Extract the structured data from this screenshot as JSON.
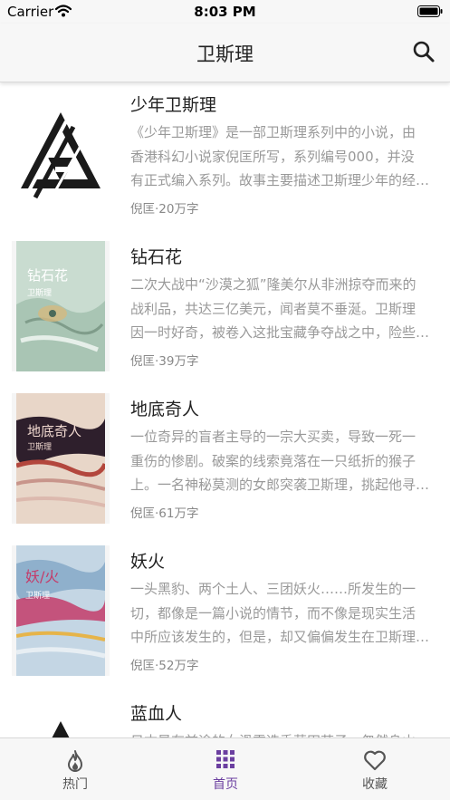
{
  "status_bar": {
    "carrier": "Carrier",
    "time": "8:03 PM"
  },
  "nav": {
    "title": "卫斯理",
    "search_icon": "search-icon"
  },
  "books": [
    {
      "title": "少年卫斯理",
      "desc_lines": [
        "《少年卫斯理》是一部卫斯理系列中的小说，由",
        "香港科幻小说家倪匡所写，系列编号000，并没",
        "有正式编入系列。故事主要描述卫斯理少年的经…"
      ],
      "meta": "倪匡·20万字",
      "cover": "triangle-logo"
    },
    {
      "title": "钻石花",
      "desc_lines": [
        "二次大战中“沙漠之狐”隆美尔从非洲掠夺而来的",
        "战利品，共达三亿美元，闻者莫不垂涎。卫斯理",
        "因一时好奇，被卷入这批宝藏争夺战之中，险些…"
      ],
      "meta": "倪匡·39万字",
      "cover": "green-book",
      "cover_text": [
        "钻石花",
        "卫斯理"
      ]
    },
    {
      "title": "地底奇人",
      "desc_lines": [
        "一位奇异的盲者主导的一宗大买卖，导致一死一",
        "重伤的惨剧。破案的线索竟落在一只纸折的猴子",
        "上。一名神秘莫测的女郎突袭卫斯理，挑起他寻…"
      ],
      "meta": "倪匡·61万字",
      "cover": "red-book",
      "cover_text": [
        "地底奇人",
        "卫斯理"
      ]
    },
    {
      "title": "妖火",
      "desc_lines": [
        "一头黑豹、两个土人、三团妖火……所发生的一",
        "切，都像是一篇小说的情节，而不像是现实生活",
        "中所应该发生的，但是，却又偏偏发生在卫斯理…"
      ],
      "meta": "倪匡·52万字",
      "cover": "blue-book",
      "cover_text": [
        "妖/火",
        "卫斯理"
      ]
    },
    {
      "title": "蓝血人",
      "desc_lines": [
        "日本是有前途的女滑雪选手草田芳子，忽然身山",
        "",
        ""
      ],
      "meta": "",
      "cover": "triangle-logo"
    }
  ],
  "tabs": [
    {
      "label": "热门",
      "icon": "flame-icon"
    },
    {
      "label": "首页",
      "icon": "grid-icon",
      "active": true
    },
    {
      "label": "收藏",
      "icon": "heart-icon"
    }
  ],
  "colors": {
    "accent": "#6b3fa0",
    "bar_bg": "#f7f7f7",
    "desc_text": "#999999"
  }
}
